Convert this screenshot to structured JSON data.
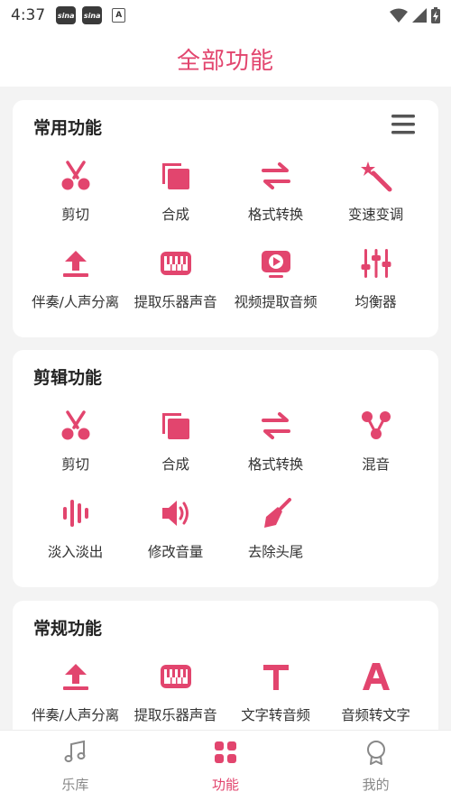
{
  "status": {
    "time": "4:37",
    "app_icon_1": "sina",
    "app_icon_2": "sina",
    "a_label": "A"
  },
  "header": {
    "title": "全部功能"
  },
  "colors": {
    "accent": "#e2456e"
  },
  "sections": [
    {
      "title": "常用功能",
      "tools": [
        {
          "label": "剪切",
          "icon": "scissors-icon"
        },
        {
          "label": "合成",
          "icon": "merge-icon"
        },
        {
          "label": "格式转换",
          "icon": "convert-arrows-icon"
        },
        {
          "label": "变速变调",
          "icon": "magic-wand-icon"
        },
        {
          "label": "伴奏/人声分离",
          "icon": "upload-arrow-icon"
        },
        {
          "label": "提取乐器声音",
          "icon": "piano-icon"
        },
        {
          "label": "视频提取音频",
          "icon": "video-play-icon"
        },
        {
          "label": "均衡器",
          "icon": "equalizer-icon"
        }
      ]
    },
    {
      "title": "剪辑功能",
      "tools": [
        {
          "label": "剪切",
          "icon": "scissors-icon"
        },
        {
          "label": "合成",
          "icon": "merge-icon"
        },
        {
          "label": "格式转换",
          "icon": "convert-arrows-icon"
        },
        {
          "label": "混音",
          "icon": "mix-icon"
        },
        {
          "label": "淡入淡出",
          "icon": "waveform-icon"
        },
        {
          "label": "修改音量",
          "icon": "volume-icon"
        },
        {
          "label": "去除头尾",
          "icon": "trowel-icon"
        }
      ]
    },
    {
      "title": "常规功能",
      "tools": [
        {
          "label": "伴奏/人声分离",
          "icon": "upload-arrow-icon"
        },
        {
          "label": "提取乐器声音",
          "icon": "piano-icon"
        },
        {
          "label": "文字转音频",
          "icon": "text-t-icon"
        },
        {
          "label": "音频转文字",
          "icon": "text-a-icon"
        }
      ]
    }
  ],
  "tabbar": {
    "tabs": [
      {
        "label": "乐库",
        "icon": "music-note-icon"
      },
      {
        "label": "功能",
        "icon": "grid-icon",
        "active": true
      },
      {
        "label": "我的",
        "icon": "profile-badge-icon"
      }
    ]
  }
}
